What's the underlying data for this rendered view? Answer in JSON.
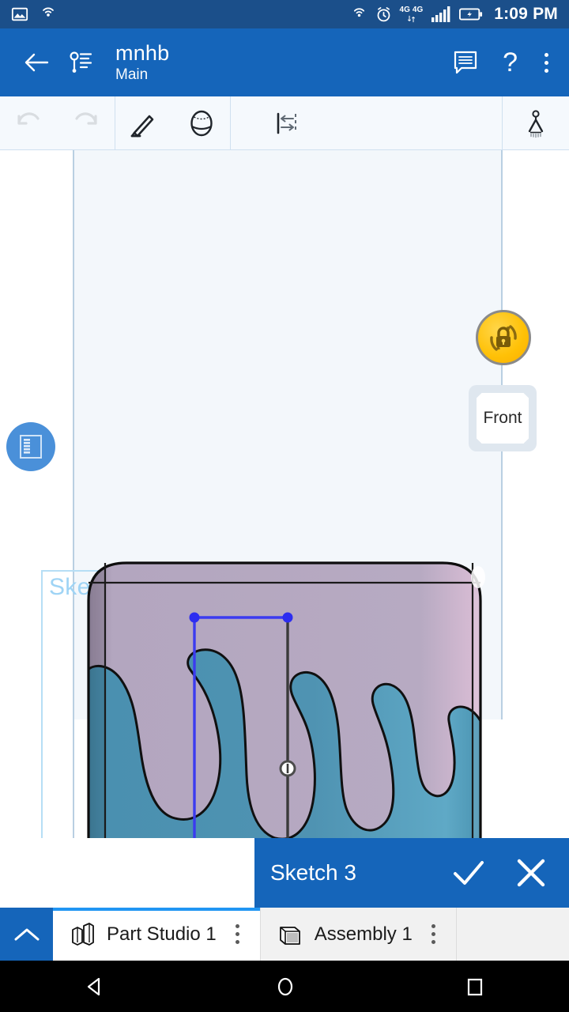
{
  "status_bar": {
    "icons_left": [
      "image-icon",
      "cast-icon"
    ],
    "icons_right": [
      "cast-icon",
      "alarm-icon",
      "network-4g-icon",
      "signal-icon",
      "battery-charging-icon"
    ],
    "network_label_1": "4G",
    "network_label_2": "4G",
    "time": "1:09 PM",
    "background": "#1b4f8a"
  },
  "app_bar": {
    "back_label": "back-arrow",
    "branch_icon": "branch-icon",
    "title": "mnhb",
    "subtitle": "Main",
    "comment_icon": "comment-icon",
    "help_label": "?",
    "overflow_label": "overflow-menu",
    "background": "#1565ba"
  },
  "toolbar": {
    "undo_label": "Undo",
    "redo_label": "Redo",
    "sketch_tool_label": "Sketch",
    "shade_tool_label": "Shaded view",
    "dimension_tool_label": "Dimension",
    "constraint_tool_label": "Constraint",
    "background": "#f5f9fd",
    "disabled_color": "#d9dde1",
    "enabled_color": "#20252b"
  },
  "canvas": {
    "panel_button_label": "feature-list-panel",
    "view_lock_label": "view-lock",
    "view_cube_face": "Front",
    "sketch_name": "Sketch 3",
    "sketch_label_color": "#9fd4f5",
    "plane_color": "#f3f7fb",
    "guide_line_color": "#b9cfe2",
    "part_top_color": "#b3a6bf",
    "part_bottom_color": "#4a90b0",
    "sketch_edge_color": "#3b3bf0",
    "sketch_point_color": "#2d2df0",
    "midpoint_constraint_label": "midpoint-constraint"
  },
  "dialog": {
    "title": "Sketch 3",
    "accept_label": "accept-checkmark",
    "cancel_label": "cancel-x",
    "background": "#1565ba"
  },
  "tab_bar": {
    "collapse_label": "collapse-chevron",
    "tabs": [
      {
        "label": "Part Studio 1",
        "icon": "part-studio-icon",
        "active": true
      },
      {
        "label": "Assembly 1",
        "icon": "assembly-icon",
        "active": false
      }
    ],
    "active_indicator_color": "#2196f3"
  },
  "nav_bar": {
    "back_label": "android-back",
    "home_label": "android-home",
    "recents_label": "android-recents",
    "background": "#000000"
  }
}
